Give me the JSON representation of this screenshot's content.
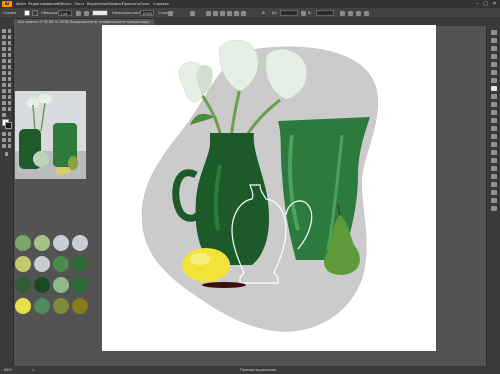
{
  "app": {
    "logo_text": "Ai",
    "menu": [
      "Файл",
      "Редактирование",
      "Объект",
      "Текст",
      "Выделение",
      "Эффект",
      "Просмотр",
      "Окно",
      "Справка"
    ],
    "window_controls": [
      "–",
      "□",
      "✕"
    ]
  },
  "control_bar": {
    "selection_label": "Группа",
    "stroke_label": "Обводка:",
    "stroke_value": "1 pt",
    "style_label": "Стиль:",
    "opacity_label": "Непрозрачность:",
    "opacity_value": "100%",
    "width_label": "Ш:",
    "height_label": "В:"
  },
  "document": {
    "tab_title": "Без имени-1* @ 66 % (RGB/Предпросмотр графического процессора)"
  },
  "status_bar": {
    "zoom": "66%",
    "artboard_number": "1",
    "tool_name": "Прямое выделение"
  },
  "palette": {
    "colors": [
      "#7aa86a",
      "#a8c189",
      "#c9cdd2",
      "#c9cdd2",
      "#c9cdd2",
      "#c6c66e",
      "#2e6a34",
      "#2e6a34",
      "#c9cdd2",
      "#4a8a4c",
      "#2f5e33",
      "#7fb17b",
      "#1b4a22",
      "#8fba8a",
      "#2e6a34",
      "#e8e04a",
      "#4e8a5e",
      "#2e6a34",
      "#7e8b3a",
      "#8b7c1a"
    ]
  },
  "colors": {
    "canvas_bg": "#535353",
    "artboard": "#ffffff",
    "blob": "#cbcbcb",
    "jug_dark": "#1d5a2a",
    "jug_light": "#2e7a3c",
    "vase": "#2c7a3e",
    "vase_light": "#4aa35a",
    "lemon": "#f2e23a",
    "pear": "#5f9a3a",
    "leaf": "#4e8a3e",
    "flower": "#e6efe6"
  }
}
